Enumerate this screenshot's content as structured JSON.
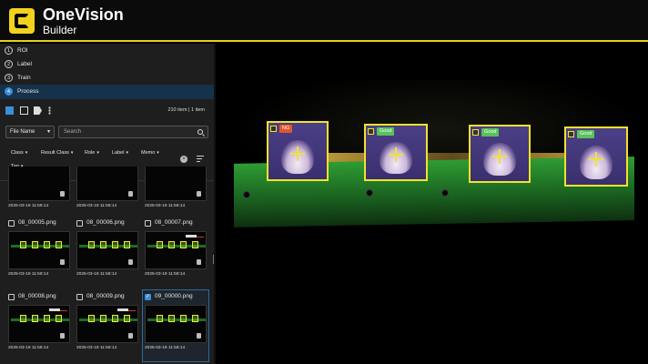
{
  "app": {
    "title": "OneVision",
    "subtitle": "Builder"
  },
  "steps": [
    {
      "num": "1",
      "label": "ROI"
    },
    {
      "num": "2",
      "label": "Label"
    },
    {
      "num": "3",
      "label": "Train"
    },
    {
      "num": "4",
      "label": "Process"
    }
  ],
  "toolbar": {
    "count": "210 item | 1 item"
  },
  "filter": {
    "field": "File Name",
    "search_placeholder": "Search"
  },
  "chips": [
    "Class",
    "Result Class",
    "Role",
    "Label",
    "Memo",
    "Tag"
  ],
  "cards": [
    {
      "name": "",
      "ts": "2025-03-19 11:58:14"
    },
    {
      "name": "",
      "ts": "2025-03-19 11:58:14"
    },
    {
      "name": "",
      "ts": "2025-03-19 11:58:14"
    },
    {
      "name": "08_00005.png",
      "ts": "2025-03-19 11:58:14"
    },
    {
      "name": "08_00006.png",
      "ts": "2025-03-19 11:58:14"
    },
    {
      "name": "08_00007.png",
      "ts": "2025-03-19 11:58:14"
    },
    {
      "name": "08_00008.png",
      "ts": "2025-03-19 11:58:14"
    },
    {
      "name": "08_00009.png",
      "ts": "2025-03-19 11:58:14"
    },
    {
      "name": "09_00000.png",
      "ts": "2025-03-19 11:58:14",
      "checked": true
    }
  ],
  "detections": [
    {
      "result": "NG"
    },
    {
      "result": "Good"
    },
    {
      "result": "Good"
    },
    {
      "result": "Good"
    }
  ],
  "colors": {
    "accent": "#f2d21c",
    "ng": "#e2562b",
    "good": "#58c25b",
    "selected": "#3b8fd6"
  }
}
